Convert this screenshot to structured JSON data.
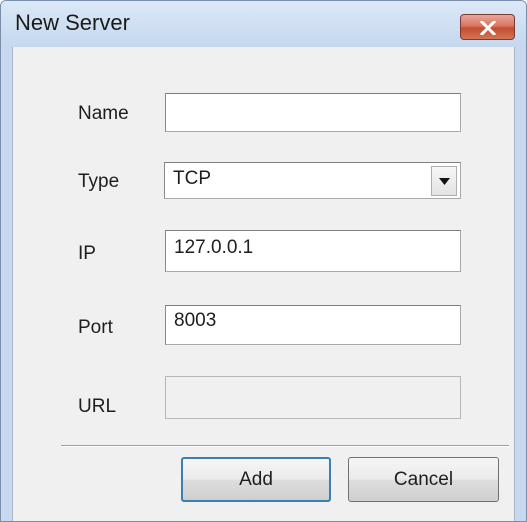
{
  "window": {
    "title": "New Server",
    "close_icon": "close-icon"
  },
  "form": {
    "name": {
      "label": "Name",
      "value": ""
    },
    "type": {
      "label": "Type",
      "value": "TCP",
      "dropdown_icon": "chevron-down-icon"
    },
    "ip": {
      "label": "IP",
      "value": "127.0.0.1"
    },
    "port": {
      "label": "Port",
      "value": "8003"
    },
    "url": {
      "label": "URL",
      "value": "",
      "disabled": true
    }
  },
  "buttons": {
    "add_label": "Add",
    "cancel_label": "Cancel"
  },
  "colors": {
    "title_bar": "#c6d9ee",
    "close_button": "#c24e31",
    "client_background": "#f0f0f0",
    "default_button_border": "#3c7fb1"
  }
}
